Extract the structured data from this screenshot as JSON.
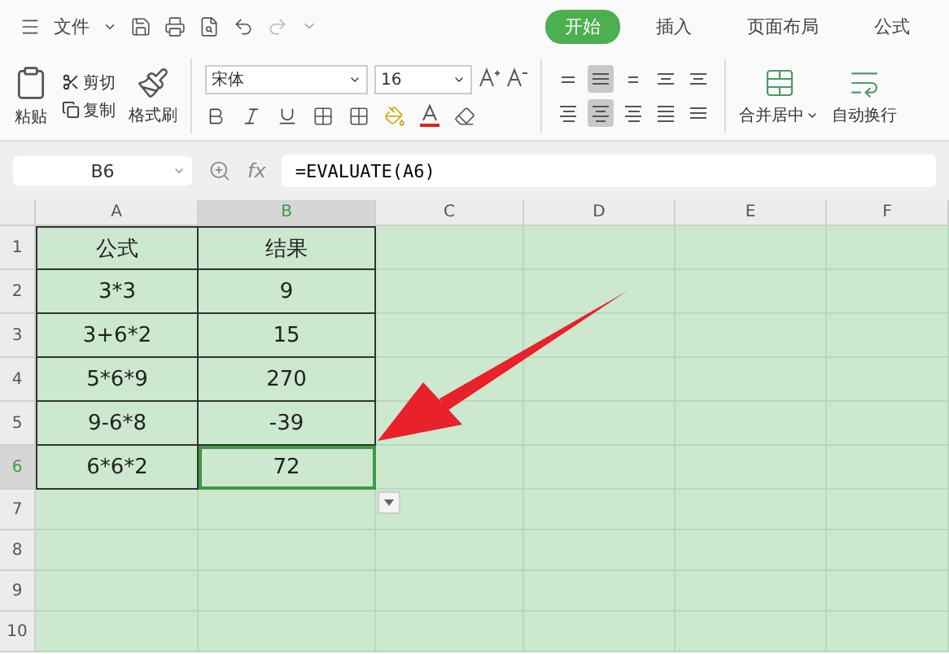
{
  "menu": {
    "label": "文件"
  },
  "tabs": [
    {
      "label": "开始",
      "selected": true
    },
    {
      "label": "插入",
      "selected": false
    },
    {
      "label": "页面布局",
      "selected": false
    },
    {
      "label": "公式",
      "selected": false
    }
  ],
  "clipboard": {
    "paste": "粘贴",
    "cut": "剪切",
    "copy": "复制",
    "format_painter": "格式刷"
  },
  "font": {
    "name": "宋体",
    "size": "16"
  },
  "align_buttons": [
    {
      "selected": false
    },
    {
      "selected": true
    },
    {
      "selected": false
    },
    {
      "selected": false
    },
    {
      "selected": false
    },
    {
      "selected": false
    },
    {
      "selected": true
    },
    {
      "selected": false
    },
    {
      "selected": false
    },
    {
      "selected": false
    }
  ],
  "merge": "合并居中",
  "wrap": "自动换行",
  "name_box": "B6",
  "function_label": "fx",
  "formula": "=EVALUATE(A6)",
  "columns": [
    {
      "label": "A",
      "selected": false
    },
    {
      "label": "B",
      "selected": true
    },
    {
      "label": "C",
      "selected": false
    },
    {
      "label": "D",
      "selected": false
    },
    {
      "label": "E",
      "selected": false
    },
    {
      "label": "F",
      "selected": false
    }
  ],
  "rows": [
    {
      "number": "1",
      "cells": [
        "公式",
        "结果"
      ],
      "selected": false
    },
    {
      "number": "2",
      "cells": [
        "3*3",
        "9"
      ],
      "selected": false
    },
    {
      "number": "3",
      "cells": [
        "3+6*2",
        "15"
      ],
      "selected": false
    },
    {
      "number": "4",
      "cells": [
        "5*6*9",
        "270"
      ],
      "selected": false
    },
    {
      "number": "5",
      "cells": [
        "9-6*8",
        "-39"
      ],
      "selected": false
    },
    {
      "number": "6",
      "cells": [
        "6*6*2",
        "72"
      ],
      "selected": true
    },
    {
      "number": "7",
      "cells": [],
      "selected": false
    },
    {
      "number": "8",
      "cells": [],
      "selected": false
    },
    {
      "number": "9",
      "cells": [],
      "selected": false
    },
    {
      "number": "10",
      "cells": [],
      "selected": false
    }
  ]
}
